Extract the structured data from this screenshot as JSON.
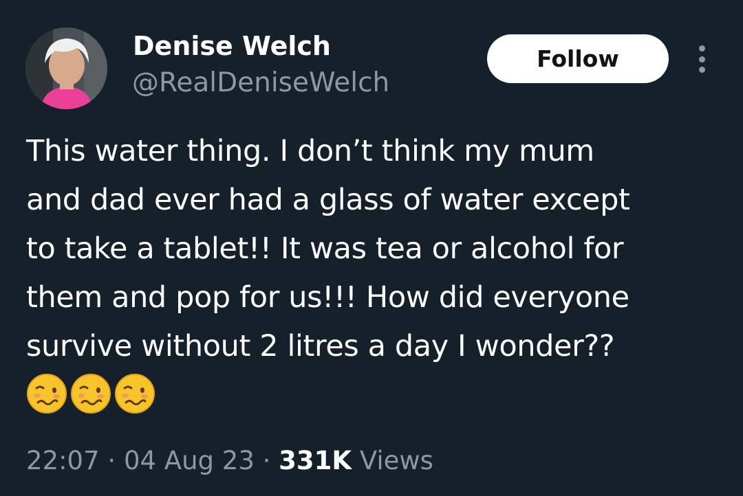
{
  "author": {
    "display_name": "Denise Welch",
    "handle": "@RealDeniseWelch"
  },
  "follow_label": "Follow",
  "tweet": {
    "lines": [
      "This water thing. I don’t think my mum",
      "and dad ever had a glass of water except",
      "to take a tablet!! It was tea or alcohol for",
      "them and pop for us!!! How did everyone",
      "survive without 2 litres a day I wonder??"
    ],
    "emojis": [
      "woozy-face",
      "woozy-face",
      "woozy-face"
    ]
  },
  "meta": {
    "time": "22:07",
    "separator": "·",
    "date": "04 Aug 23",
    "views_count": "331K",
    "views_label": "Views"
  },
  "colors": {
    "background": "#15202b",
    "secondary_text": "#8b98a5",
    "follow_button_bg": "#ffffff",
    "follow_button_text": "#0f1419"
  }
}
